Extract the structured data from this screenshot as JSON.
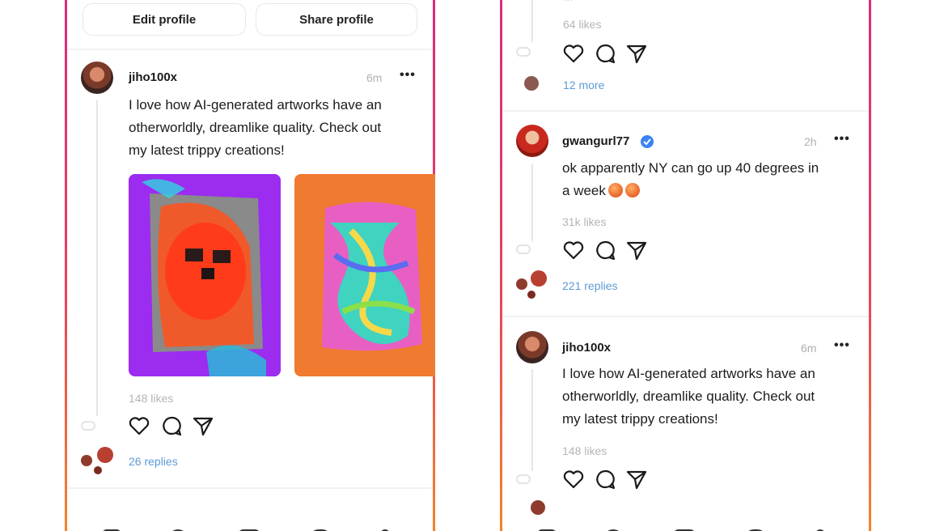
{
  "left": {
    "profile_buttons": {
      "edit": "Edit profile",
      "share": "Share profile"
    },
    "post": {
      "username": "jiho100x",
      "time": "6m",
      "more": "•••",
      "lines": [
        "I love how AI-generated artworks have an",
        "otherworldly, dreamlike quality. Check out",
        "my latest trippy creations!"
      ],
      "likes": "148 likes",
      "replies": "26 replies"
    },
    "nav_icons": [
      "home-icon",
      "search-icon",
      "compose-icon",
      "heart-icon",
      "profile-icon"
    ]
  },
  "right": {
    "top_post": {
      "partial_text": "...",
      "likes": "64 likes",
      "replies": "12 more"
    },
    "post2": {
      "username": "gwangurl77",
      "time": "2h",
      "more": "•••",
      "line1": "ok apparently NY can go up 40 degrees in",
      "line2": "a week",
      "likes": "31k likes",
      "replies": "221 replies"
    },
    "post3": {
      "username": "jiho100x",
      "time": "6m",
      "more": "•••",
      "lines": [
        "I love how AI-generated artworks have an",
        "otherworldly, dreamlike quality. Check out",
        "my latest trippy creations!"
      ],
      "likes": "148 likes"
    },
    "nav_icons": [
      "home-icon",
      "search-icon",
      "compose-icon",
      "heart-icon",
      "profile-icon"
    ]
  },
  "colors": {
    "gradient_top": "#dd2a7b",
    "gradient_bottom": "#f58529",
    "link": "#5b9bd5",
    "verified": "#3b82f6"
  }
}
